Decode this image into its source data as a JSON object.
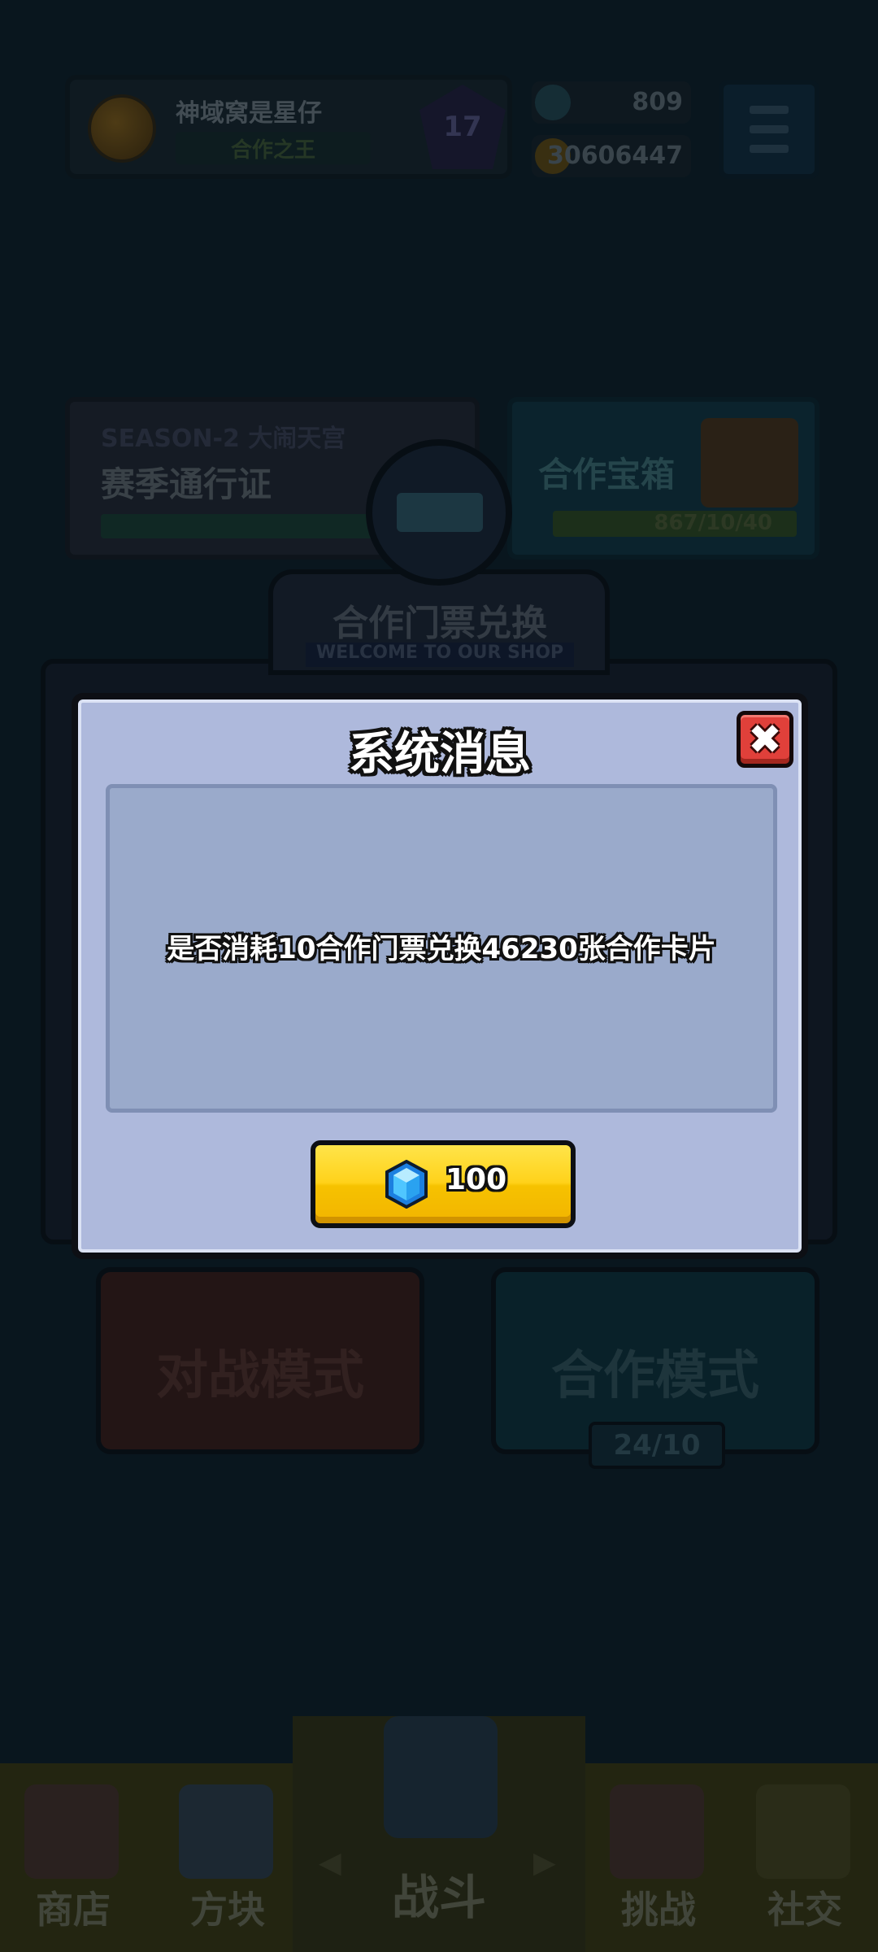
{
  "player": {
    "name": "神域窝是星仔",
    "title": "合作之王",
    "rank": "17"
  },
  "currency": {
    "gems": "809",
    "coins": "30606447"
  },
  "season": {
    "subtitle": "SEASON-2 大闹天宫",
    "title": "赛季通行证"
  },
  "chest": {
    "title": "合作宝箱",
    "progress": "867/10/40"
  },
  "shop": {
    "title": "合作门票兑换",
    "subtitle": "WELCOME TO OUR SHOP"
  },
  "modes": {
    "battle": "对战模式",
    "coop": "合作模式",
    "coop_count": "24/10"
  },
  "nav": {
    "shop": "商店",
    "blocks": "方块",
    "battle": "战斗",
    "challenge": "挑战",
    "social": "社交"
  },
  "dialog": {
    "title": "系统消息",
    "close_icon": "close-icon",
    "message": "是否消耗10合作门票兑换46230张合作卡片",
    "confirm_value": "100",
    "confirm_icon": "gem-icon"
  },
  "colors": {
    "dialog_bg": "#aeb9dc",
    "close_red": "#e0403a",
    "confirm_yellow": "#ffd21a"
  }
}
